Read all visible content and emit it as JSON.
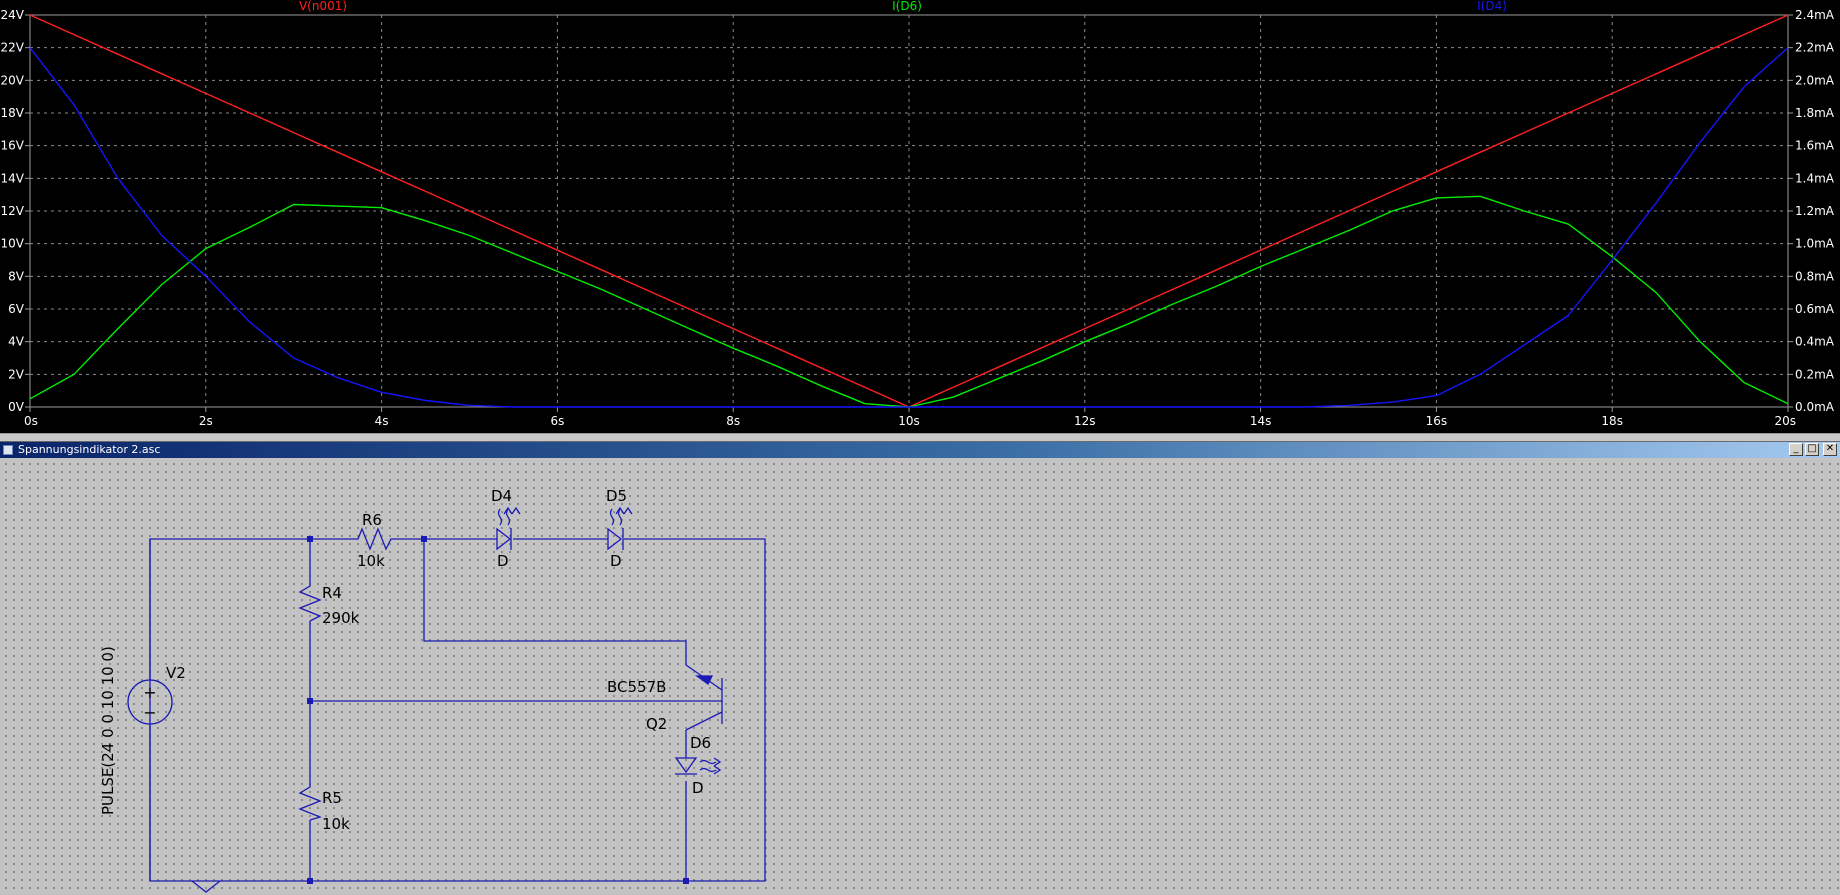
{
  "plot": {
    "background": "#000000",
    "grid": true,
    "traces": [
      {
        "label": "V(n001)",
        "color": "#ff2020"
      },
      {
        "label": "I(D6)",
        "color": "#00ee00"
      },
      {
        "label": "I(D4)",
        "color": "#1515ff"
      }
    ]
  },
  "chart_data": {
    "type": "line",
    "x": [
      0,
      0.5,
      1,
      1.5,
      2,
      2.5,
      3,
      3.5,
      4,
      4.5,
      5,
      5.5,
      6,
      6.5,
      7,
      7.5,
      8,
      8.5,
      9,
      9.5,
      10,
      10.5,
      11,
      11.5,
      12,
      12.5,
      13,
      13.5,
      14,
      14.5,
      15,
      15.5,
      16,
      16.5,
      17,
      17.5,
      18,
      18.5,
      19,
      19.5,
      20
    ],
    "xlim": [
      0,
      20
    ],
    "x_unit": "s",
    "x_tick_labels": [
      "0s",
      "2s",
      "4s",
      "6s",
      "8s",
      "10s",
      "12s",
      "14s",
      "16s",
      "18s",
      "20s"
    ],
    "left_axis": {
      "ylim": [
        0,
        24
      ],
      "tick_labels": [
        "0V",
        "2V",
        "4V",
        "6V",
        "8V",
        "10V",
        "12V",
        "14V",
        "16V",
        "18V",
        "20V",
        "22V",
        "24V"
      ]
    },
    "right_axis": {
      "ylim": [
        0,
        2.4
      ],
      "unit": "mA",
      "tick_labels": [
        "0.0mA",
        "0.2mA",
        "0.4mA",
        "0.6mA",
        "0.8mA",
        "1.0mA",
        "1.2mA",
        "1.4mA",
        "1.6mA",
        "1.8mA",
        "2.0mA",
        "2.2mA",
        "2.4mA"
      ]
    },
    "series": [
      {
        "name": "V(n001)",
        "axis": "left",
        "color": "#ff2020",
        "values": [
          24,
          22.8,
          21.6,
          20.4,
          19.2,
          18,
          16.8,
          15.6,
          14.4,
          13.2,
          12,
          10.8,
          9.6,
          8.4,
          7.2,
          6,
          4.8,
          3.6,
          2.4,
          1.2,
          0,
          1.2,
          2.4,
          3.6,
          4.8,
          6,
          7.2,
          8.4,
          9.6,
          10.8,
          12,
          13.2,
          14.4,
          15.6,
          16.8,
          18,
          19.2,
          20.4,
          21.6,
          22.8,
          24
        ]
      },
      {
        "name": "I(D6)",
        "axis": "right",
        "color": "#00ee00",
        "values": [
          0.05,
          0.2,
          0.48,
          0.75,
          0.97,
          1.1,
          1.24,
          1.23,
          1.22,
          1.14,
          1.05,
          0.94,
          0.83,
          0.72,
          0.6,
          0.48,
          0.36,
          0.25,
          0.13,
          0.02,
          0,
          0.06,
          0.17,
          0.28,
          0.4,
          0.51,
          0.63,
          0.74,
          0.86,
          0.97,
          1.08,
          1.2,
          1.28,
          1.29,
          1.2,
          1.12,
          0.92,
          0.7,
          0.4,
          0.15,
          0.02
        ]
      },
      {
        "name": "I(D4)",
        "axis": "right",
        "color": "#1515ff",
        "values": [
          2.2,
          1.85,
          1.4,
          1.05,
          0.8,
          0.52,
          0.3,
          0.18,
          0.09,
          0.04,
          0.01,
          0,
          0,
          0,
          0,
          0,
          0,
          0,
          0,
          0,
          0,
          0,
          0,
          0,
          0,
          0,
          0,
          0,
          0,
          0,
          0.01,
          0.03,
          0.07,
          0.2,
          0.38,
          0.56,
          0.9,
          1.25,
          1.62,
          1.96,
          2.2
        ]
      }
    ]
  },
  "window": {
    "title": "Spannungsindikator 2.asc",
    "btn_min": "_",
    "btn_max": "□",
    "btn_close": "✕"
  },
  "schematic": {
    "wire_color": "#1a1ab4",
    "labels": {
      "r6": "R6",
      "r6_val": "10k",
      "d4": "D4",
      "d4_model": "D",
      "d5": "D5",
      "d5_model": "D",
      "r4": "R4",
      "r4_val": "290k",
      "v2": "V2",
      "v2_spec": "PULSE(24 0 0 10 10 0)",
      "q2": "Q2",
      "q2_model": "BC557B",
      "d6": "D6",
      "d6_model": "D",
      "r5": "R5",
      "r5_val": "10k",
      "plus": "+",
      "minus": "−"
    }
  }
}
